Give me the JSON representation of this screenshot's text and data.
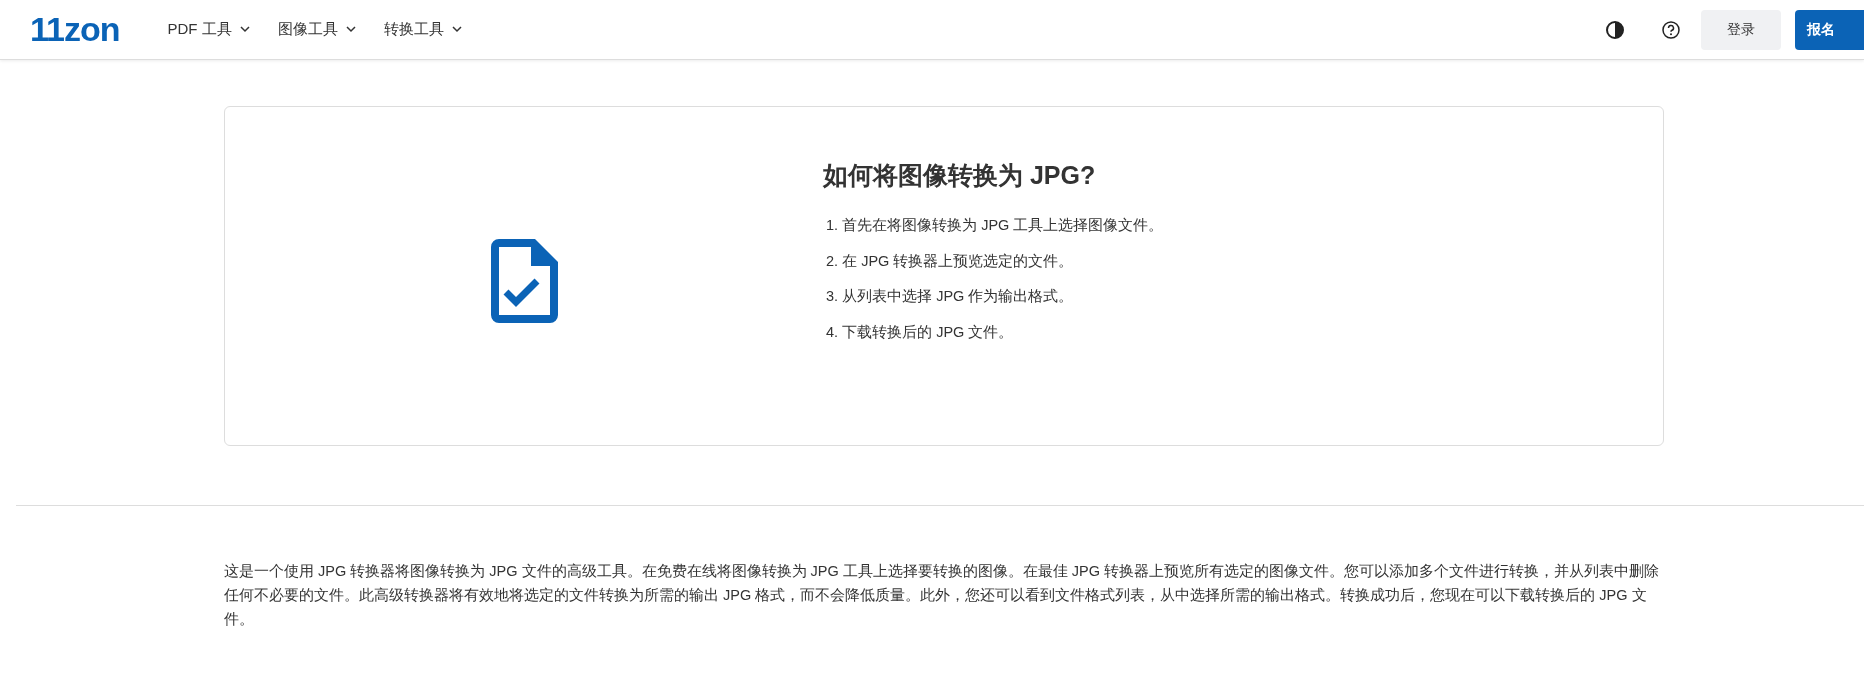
{
  "header": {
    "logo": "11zon",
    "nav": [
      {
        "label": "PDF 工具"
      },
      {
        "label": "图像工具"
      },
      {
        "label": "转换工具"
      }
    ],
    "login": "登录",
    "signup": "报名"
  },
  "how_to": {
    "title": "如何将图像转换为 JPG?",
    "steps": [
      "1. 首先在将图像转换为 JPG 工具上选择图像文件。",
      "2. 在 JPG 转换器上预览选定的文件。",
      "3. 从列表中选择 JPG 作为输出格式。",
      "4. 下载转换后的 JPG 文件。"
    ]
  },
  "description": "这是一个使用 JPG 转换器将图像转换为 JPG 文件的高级工具。在免费在线将图像转换为 JPG 工具上选择要转换的图像。在最佳 JPG 转换器上预览所有选定的图像文件。您可以添加多个文件进行转换，并从列表中删除任何不必要的文件。此高级转换器将有效地将选定的文件转换为所需的输出 JPG 格式，而不会降低质量。此外，您还可以看到文件格式列表，从中选择所需的输出格式。转换成功后，您现在可以下载转换后的 JPG 文件。"
}
